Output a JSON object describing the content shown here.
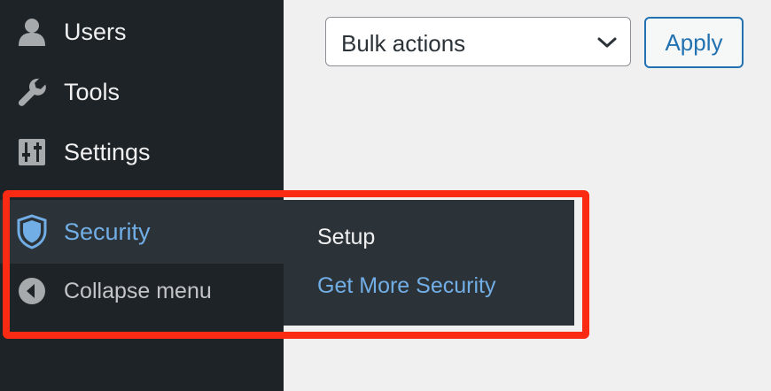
{
  "sidebar": {
    "items": [
      {
        "label": "Users",
        "icon": "user-icon"
      },
      {
        "label": "Tools",
        "icon": "wrench-icon"
      },
      {
        "label": "Settings",
        "icon": "sliders-icon"
      },
      {
        "label": "Security",
        "icon": "shield-icon",
        "active": true
      },
      {
        "label": "Collapse menu",
        "icon": "collapse-arrow-icon"
      }
    ]
  },
  "flyout": {
    "items": [
      {
        "label": "Setup"
      },
      {
        "label": "Get More Security"
      }
    ]
  },
  "toolbar": {
    "bulk_actions": {
      "selected": "Bulk actions"
    },
    "apply_label": "Apply"
  },
  "colors": {
    "sidebar_bg": "#1d2327",
    "submenu_bg": "#2c3338",
    "accent_blue": "#72aee6",
    "button_blue": "#2271b1",
    "highlight_red": "#fa2b12",
    "page_bg": "#f0f0f1"
  }
}
